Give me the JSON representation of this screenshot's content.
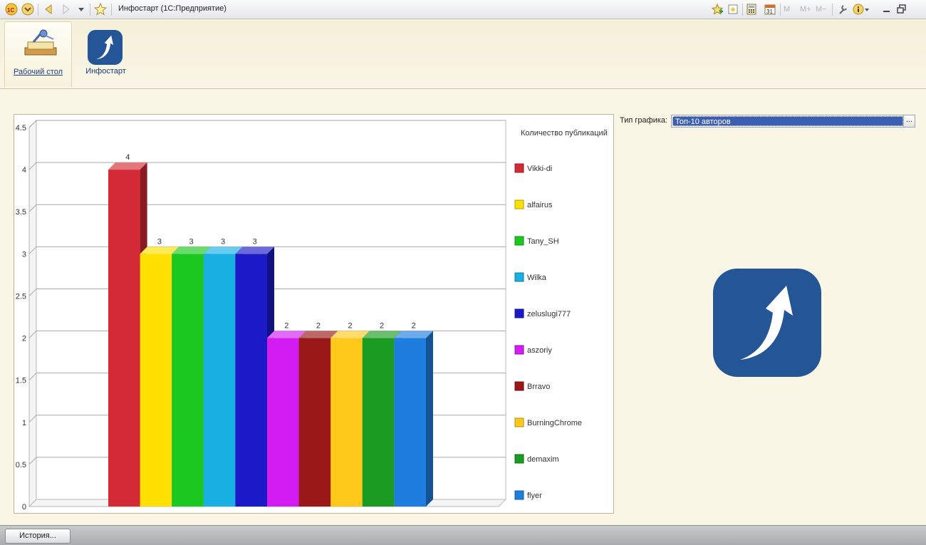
{
  "titlebar": {
    "title": "Инфостарт  (1С:Предприятие)",
    "icons": [
      "1c-logo-icon",
      "menu-icon",
      "back-icon",
      "forward-icon",
      "history-dropdown-icon",
      "favorites-star-icon",
      "add-favorite-icon",
      "favorites-list-icon",
      "calculator-icon",
      "calendar-icon",
      "memory-m-icon",
      "memory-plus-icon",
      "memory-minus-icon",
      "settings-icon",
      "info-icon",
      "minimize-icon",
      "restore-icon"
    ],
    "memory_labels": [
      "M",
      "M+",
      "M−"
    ]
  },
  "sections": [
    {
      "label": "Рабочий стол",
      "icon": "desktop-icon",
      "active": true
    },
    {
      "label": "Инфостарт",
      "icon": "infostart-icon",
      "active": false
    }
  ],
  "form": {
    "chart_type_label": "Тип графика:",
    "chart_type_value": "Топ-10 авторов",
    "chart_type_button": "..."
  },
  "bottom": {
    "history_button": "История..."
  },
  "colors": {
    "brand_blue": "#245597"
  },
  "chart_data": {
    "type": "bar",
    "title": "",
    "legend_title": "Количество публикаций",
    "legend_placement": "right",
    "ylim": [
      0,
      4.5
    ],
    "yticks": [
      "0",
      "0.5",
      "1",
      "1.5",
      "2",
      "2.5",
      "3",
      "3.5",
      "4",
      "4.5"
    ],
    "grid": true,
    "series": [
      {
        "name": "Vikki-di",
        "value": 4,
        "color": "#d42a36"
      },
      {
        "name": "alfairus",
        "value": 3,
        "color": "#ffe000"
      },
      {
        "name": "Tany_SH",
        "value": 3,
        "color": "#1bc81f"
      },
      {
        "name": "Wilka",
        "value": 3,
        "color": "#18afe3"
      },
      {
        "name": "zeluslugi777",
        "value": 3,
        "color": "#1a1ac8"
      },
      {
        "name": "aszoriy",
        "value": 2,
        "color": "#d21cf2"
      },
      {
        "name": "Brravo",
        "value": 2,
        "color": "#9a1818"
      },
      {
        "name": "BurningChrome",
        "value": 2,
        "color": "#ffc91c"
      },
      {
        "name": "demaxim",
        "value": 2,
        "color": "#1b9b22"
      },
      {
        "name": "flyer",
        "value": 2,
        "color": "#1e7ee0"
      }
    ]
  }
}
